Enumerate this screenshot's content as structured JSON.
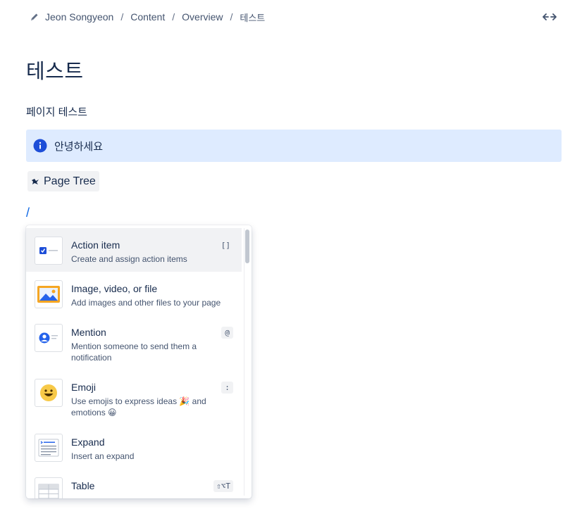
{
  "breadcrumb": {
    "items": [
      "Jeon Songyeon",
      "Content",
      "Overview"
    ],
    "current": "테스트",
    "separator": "/"
  },
  "page": {
    "title": "테스트",
    "paragraph": "페이지 테스트",
    "info_panel_text": "안녕하세요",
    "macro_label": "Page Tree",
    "slash_text": "/"
  },
  "menu": {
    "items": [
      {
        "title": "Action item",
        "description": "Create and assign action items",
        "shortcut": "[]",
        "icon": "action-item-icon"
      },
      {
        "title": "Image, video, or file",
        "description": "Add images and other files to your page",
        "shortcut": "",
        "icon": "image-icon"
      },
      {
        "title": "Mention",
        "description": "Mention someone to send them a notification",
        "shortcut": "@",
        "icon": "mention-icon"
      },
      {
        "title": "Emoji",
        "description": "Use emojis to express ideas 🎉 and emotions 😀",
        "shortcut": ":",
        "icon": "emoji-icon"
      },
      {
        "title": "Expand",
        "description": "Insert an expand",
        "shortcut": "",
        "icon": "expand-icon"
      },
      {
        "title": "Table",
        "description": "",
        "shortcut": "⇧⌥T",
        "icon": "table-icon"
      }
    ]
  },
  "colors": {
    "info_bg": "#deebff",
    "info_icon": "#1d4ed8",
    "link": "#0c66e4",
    "selected_bg": "#f1f2f4"
  }
}
